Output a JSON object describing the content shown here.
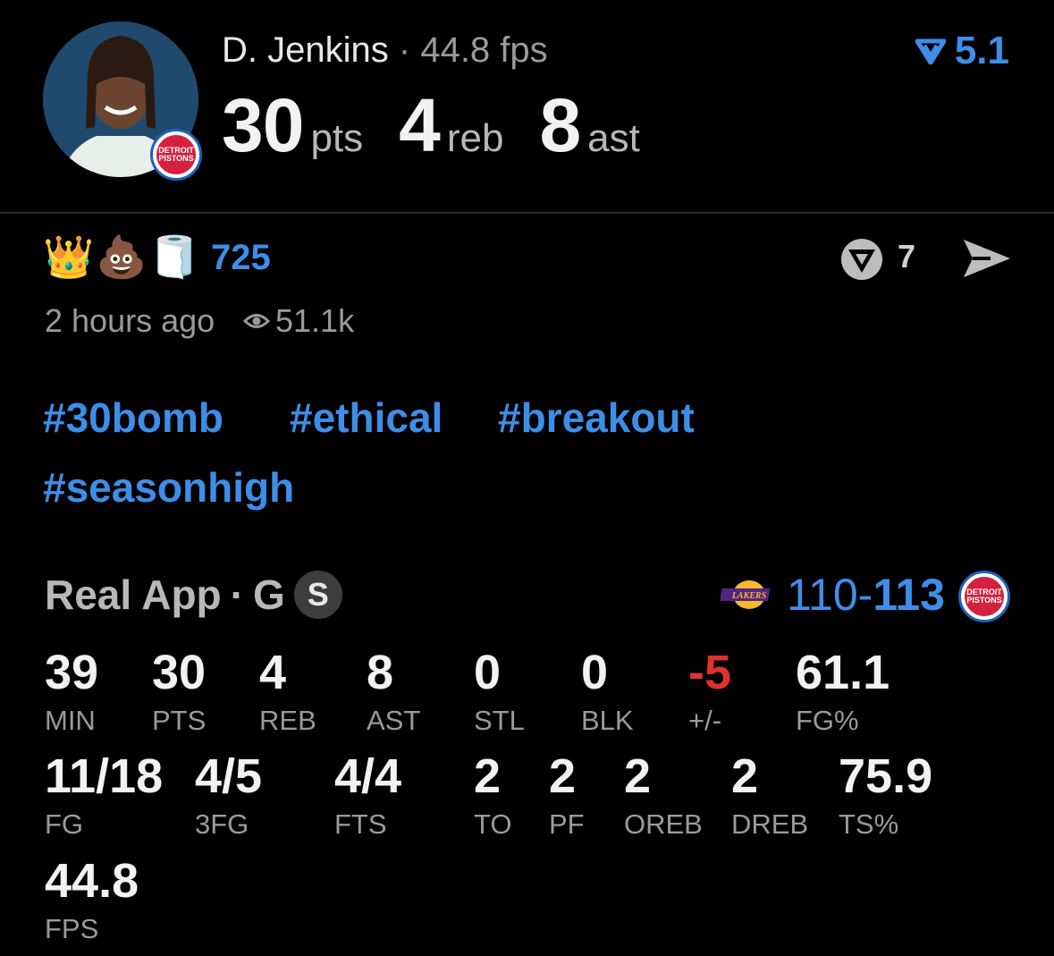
{
  "player": {
    "name": "D. Jenkins",
    "separator": "·",
    "fps": "44.8 fps",
    "team_badge": "DETROIT PISTONS",
    "headline": [
      {
        "value": "30",
        "label": "pts"
      },
      {
        "value": "4",
        "label": "reb"
      },
      {
        "value": "8",
        "label": "ast"
      }
    ]
  },
  "rating": {
    "icon": "real-app-v-icon",
    "value": "5.1"
  },
  "reactions": {
    "emojis": [
      "👑",
      "💩",
      "🧻"
    ],
    "count": "725",
    "comments": "7",
    "time_ago": "2 hours ago",
    "views": "51.1k"
  },
  "hashtags": [
    "#30bomb",
    "#ethical",
    "#breakout",
    "#seasonhigh"
  ],
  "game": {
    "source": "Real App",
    "separator": "·",
    "position": "G",
    "badge": "S",
    "away_score": "110",
    "dash": "-",
    "home_score": "113",
    "away_team_logo": "LAKERS",
    "home_team_logo": "DETROIT PISTONS"
  },
  "stats_row1": [
    {
      "value": "39",
      "label": "MIN"
    },
    {
      "value": "30",
      "label": "PTS"
    },
    {
      "value": "4",
      "label": "REB"
    },
    {
      "value": "8",
      "label": "AST"
    },
    {
      "value": "0",
      "label": "STL"
    },
    {
      "value": "0",
      "label": "BLK"
    },
    {
      "value": "-5",
      "label": "+/-"
    },
    {
      "value": "61.1",
      "label": "FG%"
    }
  ],
  "stats_row2": [
    {
      "value": "11/18",
      "label": "FG"
    },
    {
      "value": "4/5",
      "label": "3FG"
    },
    {
      "value": "4/4",
      "label": "FTS"
    },
    {
      "value": "2",
      "label": "TO"
    },
    {
      "value": "2",
      "label": "PF"
    },
    {
      "value": "2",
      "label": "OREB"
    },
    {
      "value": "2",
      "label": "DREB"
    },
    {
      "value": "75.9",
      "label": "TS%"
    }
  ],
  "stats_row3": [
    {
      "value": "44.8",
      "label": "FPS"
    }
  ],
  "colors": {
    "accent": "#3d8ee8",
    "negative": "#e0312e",
    "background": "#000000"
  }
}
